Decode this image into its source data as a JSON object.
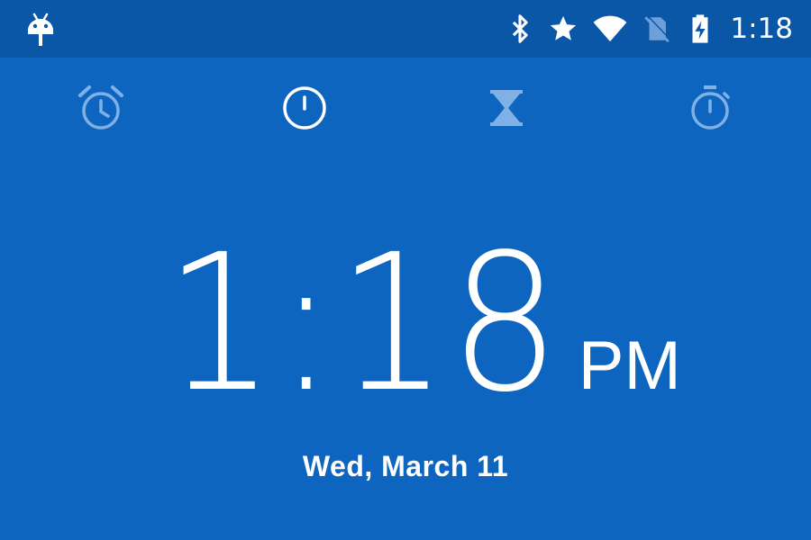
{
  "status_bar": {
    "time": "1:18",
    "icons": [
      "android-debug-icon",
      "bluetooth-icon",
      "star-icon",
      "wifi-icon",
      "no-sim-icon",
      "battery-charging-icon"
    ]
  },
  "tabs": [
    {
      "name": "alarm",
      "icon": "alarm-clock-icon",
      "selected": false
    },
    {
      "name": "clock",
      "icon": "clock-icon",
      "selected": true
    },
    {
      "name": "timer",
      "icon": "hourglass-icon",
      "selected": false
    },
    {
      "name": "stopwatch",
      "icon": "stopwatch-icon",
      "selected": false
    }
  ],
  "clock": {
    "time": "1:18",
    "ampm": "PM",
    "date": "Wed, March 11"
  },
  "colors": {
    "background": "#0d65c0",
    "status_bar": "#0a57a8",
    "selected_icon": "#ffffff",
    "inactive_icon": "#7fb0e6"
  }
}
